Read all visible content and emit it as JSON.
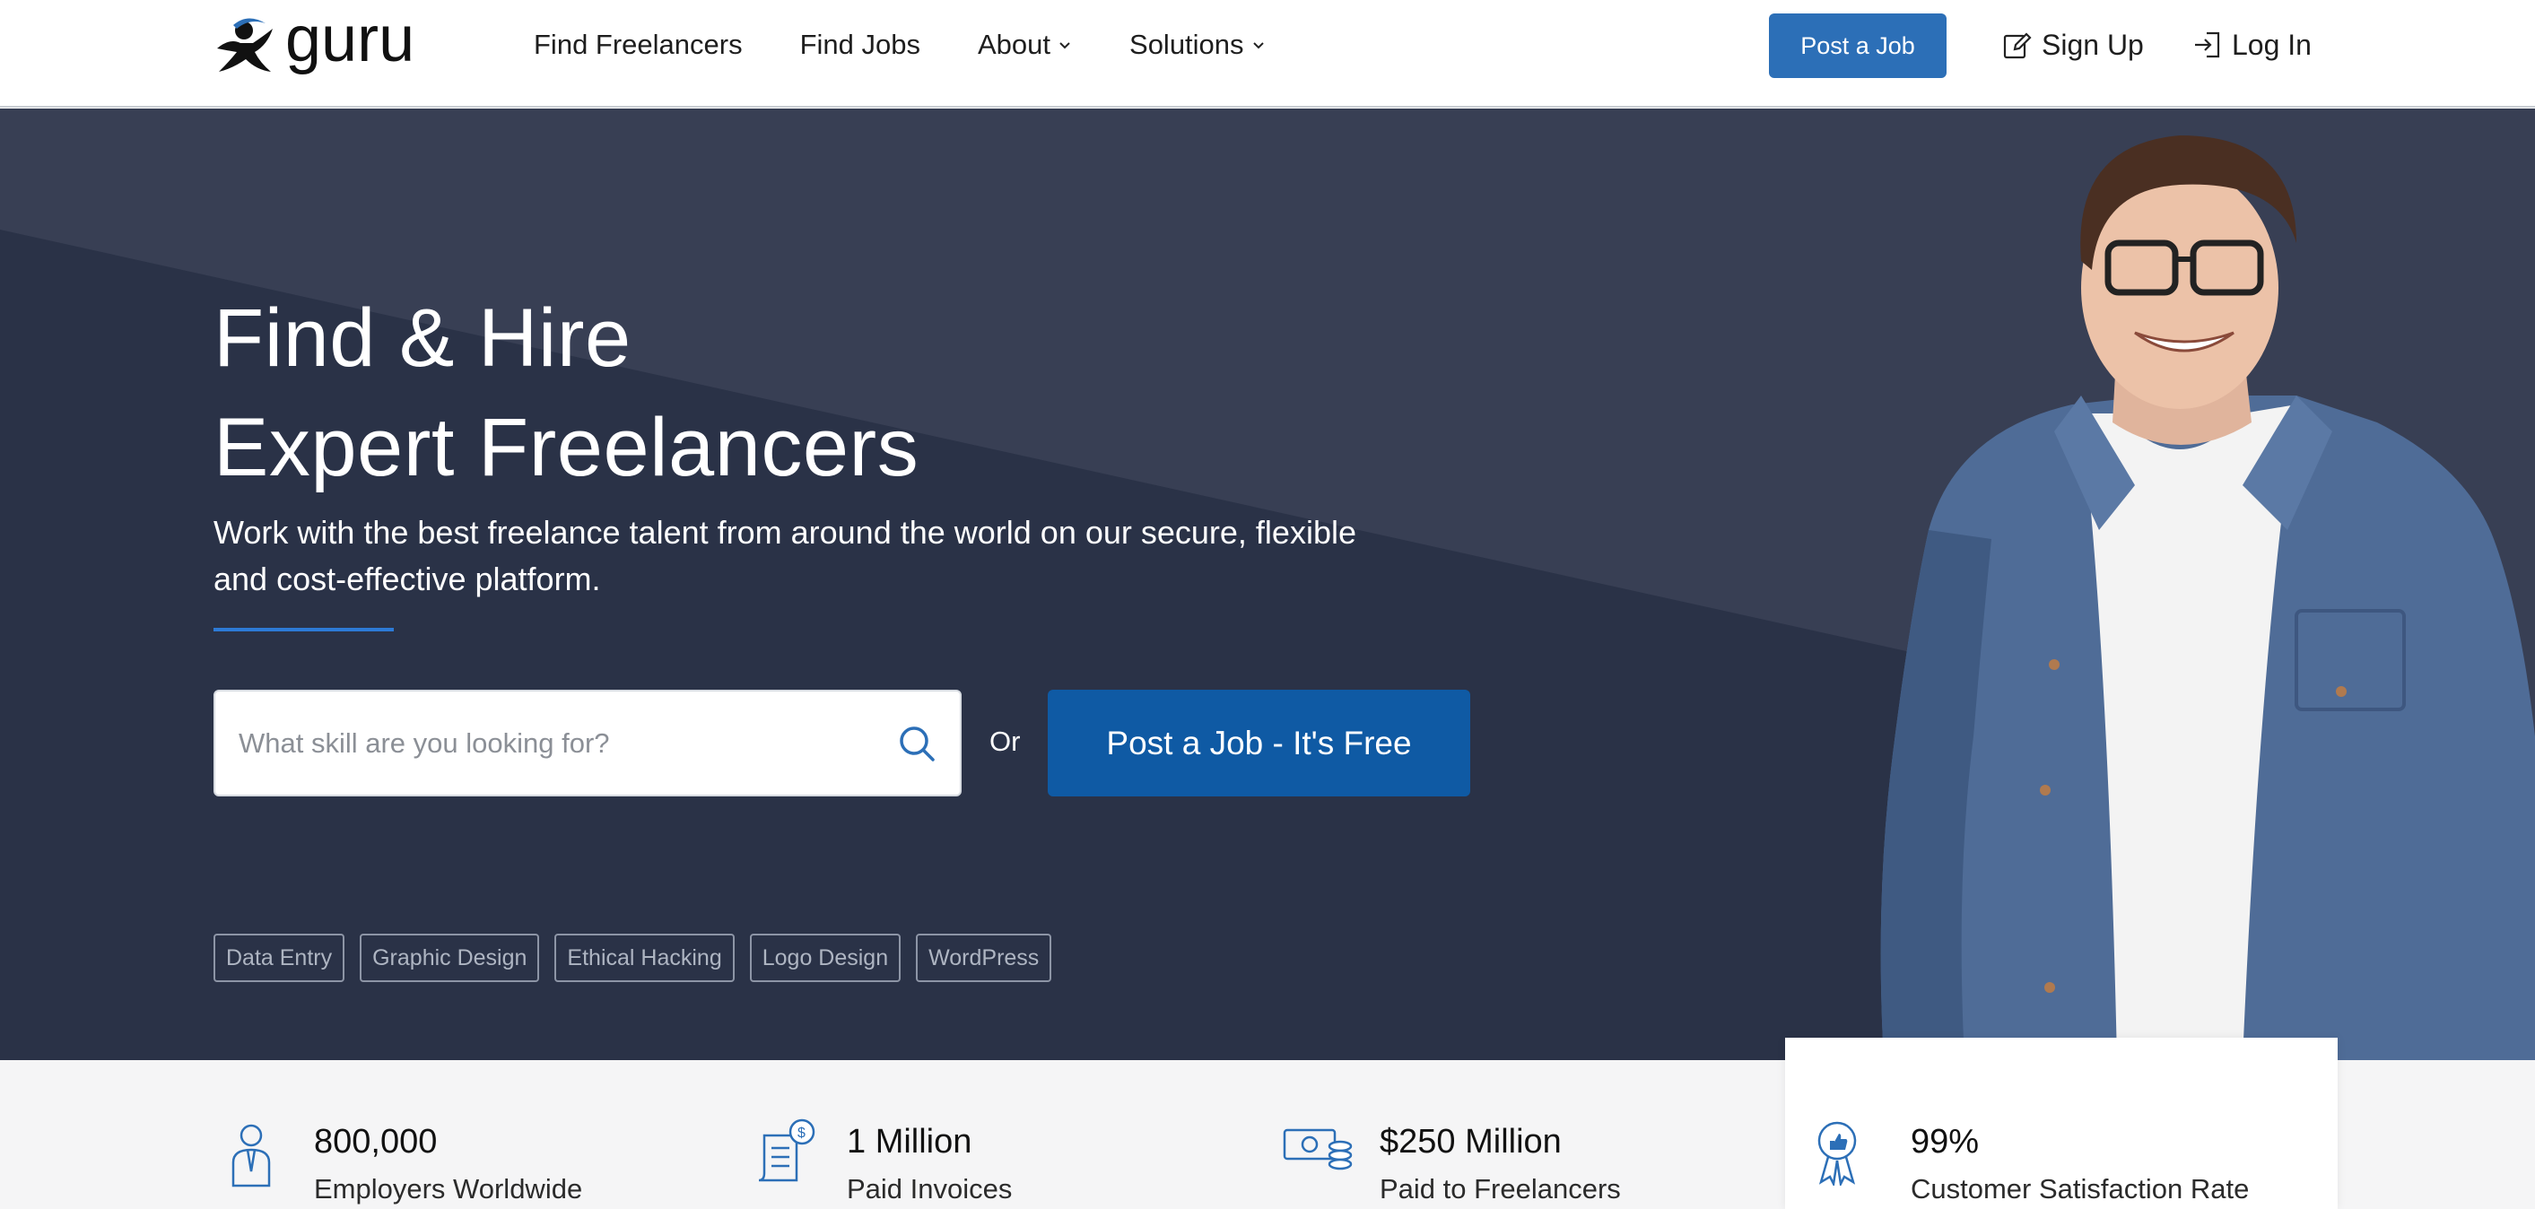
{
  "header": {
    "logo_text": "guru",
    "nav": [
      {
        "label": "Find Freelancers",
        "dropdown": false
      },
      {
        "label": "Find Jobs",
        "dropdown": false
      },
      {
        "label": "About",
        "dropdown": true
      },
      {
        "label": "Solutions",
        "dropdown": true
      }
    ],
    "post_job_label": "Post a Job",
    "signup_label": "Sign Up",
    "login_label": "Log In"
  },
  "hero": {
    "title_line1": "Find & Hire",
    "title_line2": "Expert Freelancers",
    "subtitle": "Work with the best freelance talent from around the world on our secure, flexible and cost-effective platform.",
    "search_placeholder": "What skill are you looking for?",
    "or_label": "Or",
    "post_job_cta": "Post a Job - It's Free",
    "tags": [
      "Data Entry",
      "Graphic Design",
      "Ethical Hacking",
      "Logo Design",
      "WordPress"
    ]
  },
  "stats": [
    {
      "value": "800,000",
      "label": "Employers Worldwide",
      "icon": "employer-icon"
    },
    {
      "value": "1 Million",
      "label": "Paid Invoices",
      "icon": "invoice-icon"
    },
    {
      "value": "$250 Million",
      "label": "Paid to Freelancers",
      "icon": "money-icon"
    },
    {
      "value": "99%",
      "label": "Customer Satisfaction Rate",
      "icon": "award-icon"
    }
  ],
  "colors": {
    "brand_blue": "#2c6fb7",
    "cta_blue": "#0f5aa4",
    "hero_bg": "#2a3247",
    "accent_line": "#2d7ad6"
  }
}
